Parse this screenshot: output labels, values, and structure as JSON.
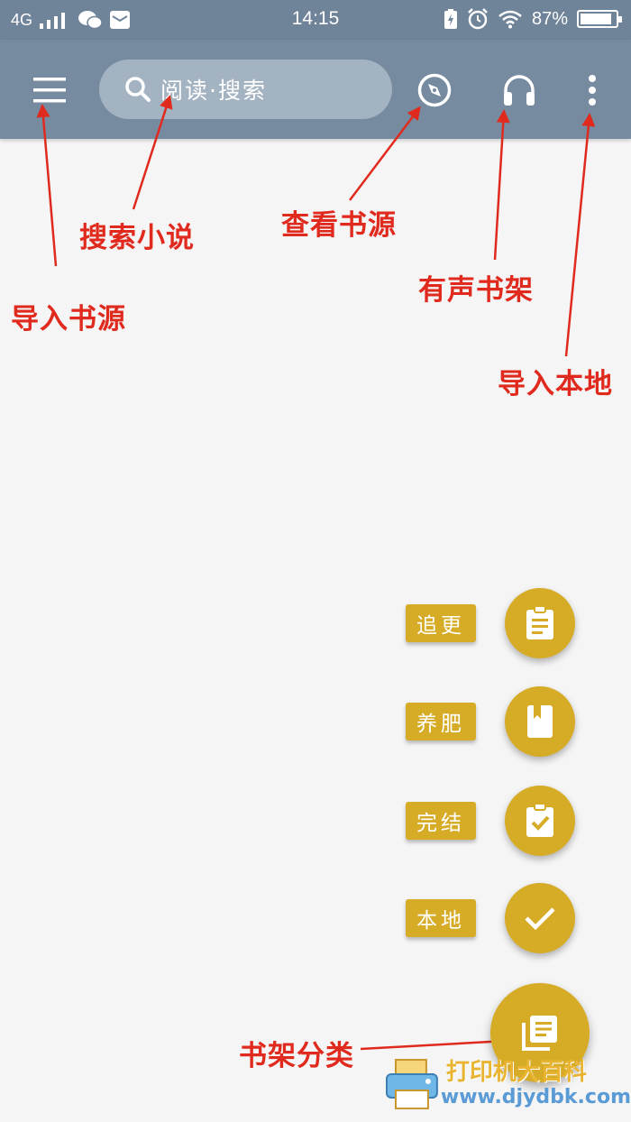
{
  "status_bar": {
    "network": "4G",
    "time": "14:15",
    "battery": "87%",
    "icons": [
      "signal-icon",
      "wechat-icon",
      "mail-icon",
      "charging-icon",
      "alarm-icon",
      "wifi-icon",
      "battery-icon"
    ]
  },
  "toolbar": {
    "search_placeholder": "阅读·搜索",
    "icons": [
      "menu-icon",
      "search-icon",
      "compass-icon",
      "headphones-icon",
      "more-vert-icon"
    ]
  },
  "annotations": {
    "import_source": "导入书源",
    "search_novel": "搜索小说",
    "view_source": "查看书源",
    "audio_shelf": "有声书架",
    "import_local": "导入本地",
    "shelf_category": "书架分类"
  },
  "fab_menu": [
    {
      "label": "追更",
      "icon": "clipboard-list-icon"
    },
    {
      "label": "养肥",
      "icon": "book-bookmark-icon"
    },
    {
      "label": "完结",
      "icon": "clipboard-check-icon"
    },
    {
      "label": "本地",
      "icon": "check-icon"
    }
  ],
  "fab_main": {
    "icon": "library-books-icon"
  },
  "watermark": {
    "text": "打印机大百科",
    "url": "www.djydbk.com"
  },
  "colors": {
    "toolbar": "#768ba0",
    "status_bar": "#6f8399",
    "accent": "#d6ab26",
    "annotation": "#e02a1e",
    "background": "#f5f5f5"
  }
}
